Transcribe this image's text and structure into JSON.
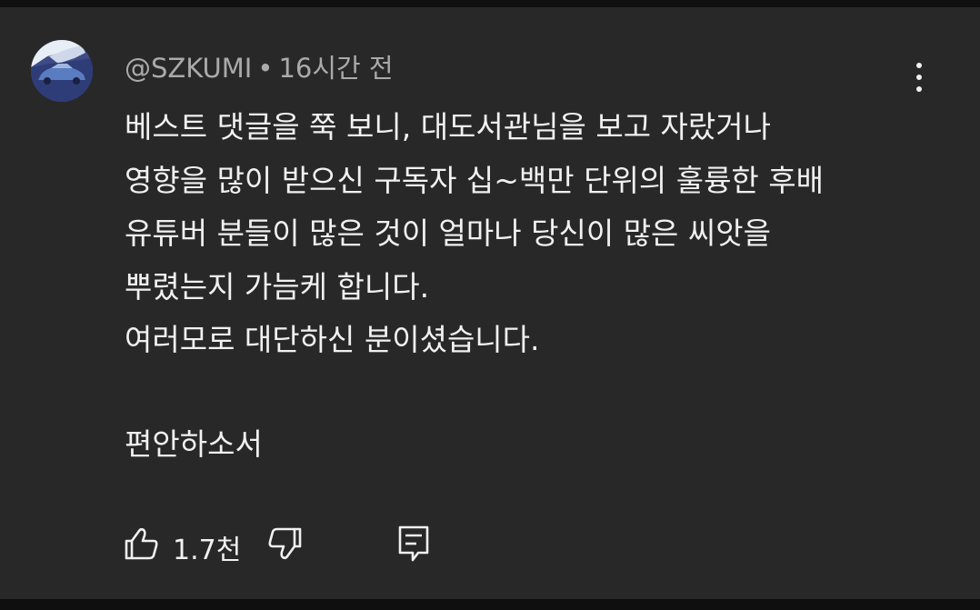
{
  "comment": {
    "author": "@SZKUMI",
    "separator": "•",
    "time": "16시간 전",
    "lines": [
      "베스트 댓글을 쭉 보니, 대도서관님을 보고 자랐거나",
      "영향을 많이 받으신 구독자 십~백만 단위의 훌륭한 후배",
      "유튜버 분들이 많은 것이 얼마나 당신이 많은 씨앗을",
      "뿌렸는지 가늠케 합니다.",
      "여러모로 대단하신 분이셨습니다."
    ],
    "closing": "편안하소서",
    "likes": "1.7천"
  },
  "icons": {
    "avatar": "avatar-car-image",
    "more": "more-vert-icon",
    "like": "thumbs-up-icon",
    "dislike": "thumbs-down-icon",
    "reply": "reply-comment-icon"
  },
  "colors": {
    "background": "#282828",
    "text": "#f1f1f1",
    "meta": "#aaaaaa"
  }
}
